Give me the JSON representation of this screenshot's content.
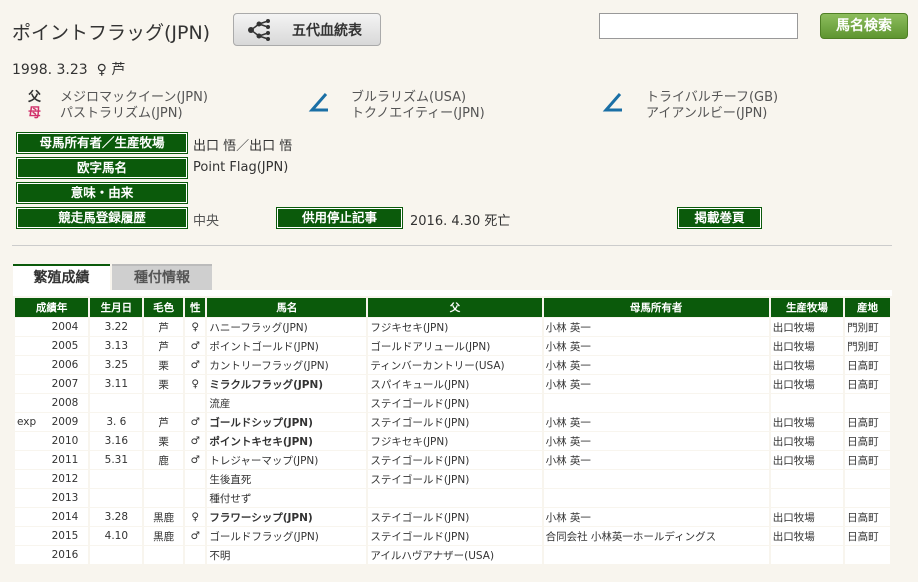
{
  "horse": {
    "name": "ポイントフラッグ(JPN)",
    "birth": "1998. 3.23",
    "sex_symbol": "♀",
    "color": "芦"
  },
  "header": {
    "pedigree_button": "五代血統表",
    "search_placeholder": "",
    "search_button": "馬名検索"
  },
  "pedigree": {
    "father_label": "父",
    "mother_label": "母",
    "father": "メジロマックイーン(JPN)",
    "mother": "パストラリズム(JPN)",
    "dam_sire": "ブルラリズム(USA)",
    "dam_dam": "トクノエイティー(JPN)",
    "g_sire": "トライバルチーフ(GB)",
    "g_dam": "アイアンルビー(JPN)"
  },
  "info": {
    "owner_label": "母馬所有者／生産牧場",
    "owner_value": "出口 悟／出口 悟",
    "roman_label": "欧字馬名",
    "roman_value": "Point Flag(JPN)",
    "meaning_label": "意味・由来",
    "history_label": "競走馬登録履歴",
    "history_value": "中央",
    "retire_label": "供用停止記事",
    "retire_value": "2016. 4.30 死亡",
    "page_label": "掲載巻頁"
  },
  "tabs": {
    "breeding": "繁殖成績",
    "stud": "種付情報"
  },
  "table": {
    "headers": [
      "成績年",
      "生月日",
      "毛色",
      "性",
      "馬名",
      "父",
      "母馬所有者",
      "生産牧場",
      "産地"
    ],
    "rows": [
      {
        "prefix": "",
        "year": "2004",
        "date": "3.22",
        "color": "芦",
        "sex": "♀",
        "name": "ハニーフラッグ(JPN)",
        "sire": "フジキセキ(JPN)",
        "owner": "小林 英一",
        "farm": "出口牧場",
        "area": "門別町"
      },
      {
        "prefix": "",
        "year": "2005",
        "date": "3.13",
        "color": "芦",
        "sex": "♂",
        "name": "ポイントゴールド(JPN)",
        "sire": "ゴールドアリュール(JPN)",
        "owner": "小林 英一",
        "farm": "出口牧場",
        "area": "門別町"
      },
      {
        "prefix": "",
        "year": "2006",
        "date": "3.25",
        "color": "栗",
        "sex": "♂",
        "name": "カントリーフラッグ(JPN)",
        "sire": "ティンバーカントリー(USA)",
        "owner": "小林 英一",
        "farm": "出口牧場",
        "area": "日高町"
      },
      {
        "prefix": "",
        "year": "2007",
        "date": "3.11",
        "color": "栗",
        "sex": "♀",
        "name": "ミラクルフラッグ(JPN)",
        "sire": "スパイキュール(JPN)",
        "owner": "小林 英一",
        "farm": "出口牧場",
        "area": "日高町"
      },
      {
        "prefix": "",
        "year": "2008",
        "date": "",
        "color": "",
        "sex": "",
        "name": "流産",
        "sire": "ステイゴールド(JPN)",
        "owner": "",
        "farm": "",
        "area": ""
      },
      {
        "prefix": "exp",
        "year": "2009",
        "date": "3. 6",
        "color": "芦",
        "sex": "♂",
        "name": "ゴールドシップ(JPN)",
        "sire": "ステイゴールド(JPN)",
        "owner": "小林 英一",
        "farm": "出口牧場",
        "area": "日高町"
      },
      {
        "prefix": "",
        "year": "2010",
        "date": "3.16",
        "color": "栗",
        "sex": "♂",
        "name": "ポイントキセキ(JPN)",
        "sire": "フジキセキ(JPN)",
        "owner": "小林 英一",
        "farm": "出口牧場",
        "area": "日高町"
      },
      {
        "prefix": "",
        "year": "2011",
        "date": "5.31",
        "color": "鹿",
        "sex": "♂",
        "name": "トレジャーマップ(JPN)",
        "sire": "ステイゴールド(JPN)",
        "owner": "小林 英一",
        "farm": "出口牧場",
        "area": "日高町"
      },
      {
        "prefix": "",
        "year": "2012",
        "date": "",
        "color": "",
        "sex": "",
        "name": "生後直死",
        "sire": "ステイゴールド(JPN)",
        "owner": "",
        "farm": "",
        "area": ""
      },
      {
        "prefix": "",
        "year": "2013",
        "date": "",
        "color": "",
        "sex": "",
        "name": "種付せず",
        "sire": "",
        "owner": "",
        "farm": "",
        "area": ""
      },
      {
        "prefix": "",
        "year": "2014",
        "date": "3.28",
        "color": "黒鹿",
        "sex": "♀",
        "name": "フラワーシップ(JPN)",
        "sire": "ステイゴールド(JPN)",
        "owner": "小林 英一",
        "farm": "出口牧場",
        "area": "日高町"
      },
      {
        "prefix": "",
        "year": "2015",
        "date": "4.10",
        "color": "黒鹿",
        "sex": "♂",
        "name": "ゴールドフラッグ(JPN)",
        "sire": "ステイゴールド(JPN)",
        "owner": "合同会社 小林英一ホールディングス",
        "farm": "出口牧場",
        "area": "日高町"
      },
      {
        "prefix": "",
        "year": "2016",
        "date": "",
        "color": "",
        "sex": "",
        "name": "不明",
        "sire": "アイルハヴアナザー(USA)",
        "owner": "",
        "farm": "",
        "area": ""
      }
    ]
  }
}
